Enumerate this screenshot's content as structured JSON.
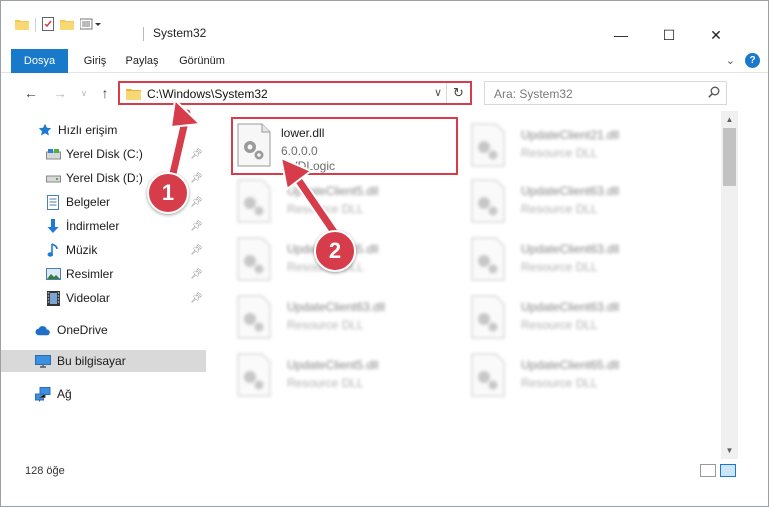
{
  "window": {
    "title": "System32",
    "controls": {
      "minimize": "—",
      "maximize": "☐",
      "close": "✕"
    }
  },
  "ribbon": {
    "tabs": [
      "Dosya",
      "Giriş",
      "Paylaş",
      "Görünüm"
    ]
  },
  "address": {
    "path": "C:\\Windows\\System32",
    "search_placeholder": "Ara: System32"
  },
  "sidebar": {
    "quick_access": "Hızlı erişim",
    "items": [
      {
        "label": "Yerel Disk (C:)",
        "icon": "drive-icon",
        "pinned": true
      },
      {
        "label": "Yerel Disk (D:)",
        "icon": "drive-icon",
        "pinned": true
      },
      {
        "label": "Belgeler",
        "icon": "documents-icon",
        "pinned": true
      },
      {
        "label": "İndirmeler",
        "icon": "downloads-icon",
        "pinned": true
      },
      {
        "label": "Müzik",
        "icon": "music-icon",
        "pinned": true
      },
      {
        "label": "Resimler",
        "icon": "pictures-icon",
        "pinned": true
      },
      {
        "label": "Videolar",
        "icon": "videos-icon",
        "pinned": true
      }
    ],
    "onedrive": "OneDrive",
    "this_pc": "Bu bilgisayar",
    "network": "Ağ"
  },
  "files": {
    "selected": {
      "name": "lower.dll",
      "version": "6.0.0.0",
      "company": "DVDLogic"
    },
    "blurred": [
      {
        "name": "UpdateClient21.dll",
        "type": "Resource DLL"
      },
      {
        "name": "UpdateClient5.dll",
        "type": "Resource DLL"
      },
      {
        "name": "UpdateClient63.dll",
        "type": "Resource DLL"
      },
      {
        "name": "UpdateClient5.dll",
        "type": "Resource DLL"
      },
      {
        "name": "UpdateClient63.dll",
        "type": "Resource DLL"
      },
      {
        "name": "UpdateClient63.dll",
        "type": "Resource DLL"
      },
      {
        "name": "UpdateClient63.dll",
        "type": "Resource DLL"
      },
      {
        "name": "UpdateClient5.dll",
        "type": "Resource DLL"
      },
      {
        "name": "UpdateClient65.dll",
        "type": "Resource DLL"
      }
    ]
  },
  "status": {
    "count": "128 öğe"
  },
  "annotations": {
    "badge1": "1",
    "badge2": "2",
    "color": "#d63c4a"
  }
}
